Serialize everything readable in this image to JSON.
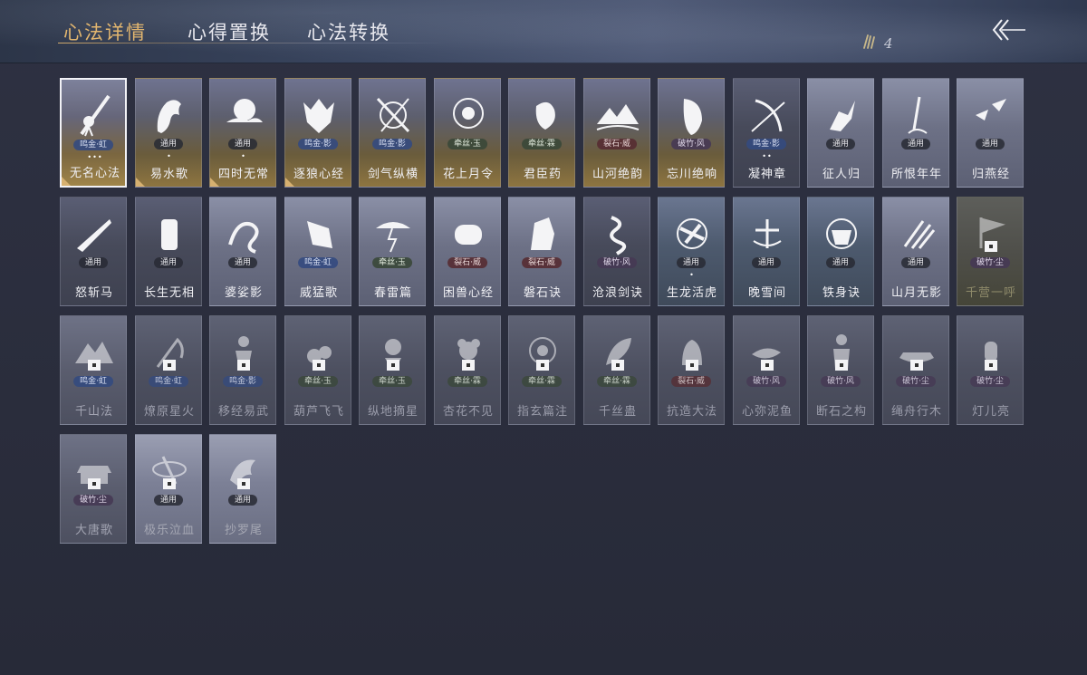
{
  "tabs": [
    {
      "label": "心法详情",
      "active": true
    },
    {
      "label": "心得置换",
      "active": false
    },
    {
      "label": "心法转换",
      "active": false
    }
  ],
  "currency": {
    "icon": "feather-tokens-icon",
    "value": "4"
  },
  "back_icon": "double-chevron-back-icon",
  "cards": [
    {
      "name": "无名心法",
      "tag": "鸣金·虹",
      "tag_color": "blue",
      "dots": "•••",
      "style": "gold first",
      "icon": "sword-pendant",
      "equipped": true,
      "locked": false
    },
    {
      "name": "易水歌",
      "tag": "通用",
      "tag_color": "dark",
      "dots": "•",
      "style": "gold",
      "icon": "horse",
      "equipped": true,
      "locked": false
    },
    {
      "name": "四时无常",
      "tag": "通用",
      "tag_color": "dark",
      "dots": "•",
      "style": "gold",
      "icon": "moon-cloud",
      "equipped": true,
      "locked": false
    },
    {
      "name": "逐狼心经",
      "tag": "鸣金·影",
      "tag_color": "blue",
      "dots": "",
      "style": "gold",
      "icon": "wolf",
      "equipped": true,
      "locked": false
    },
    {
      "name": "剑气纵横",
      "tag": "鸣金·影",
      "tag_color": "blue",
      "dots": "",
      "style": "gold",
      "icon": "swords-crossed",
      "equipped": false,
      "locked": false
    },
    {
      "name": "花上月令",
      "tag": "牵丝·玉",
      "tag_color": "green",
      "dots": "",
      "style": "gold",
      "icon": "flower-moon",
      "equipped": false,
      "locked": false
    },
    {
      "name": "君臣药",
      "tag": "牵丝·霖",
      "tag_color": "green",
      "dots": "",
      "style": "gold",
      "icon": "gourd",
      "equipped": false,
      "locked": false
    },
    {
      "name": "山河绝韵",
      "tag": "裂石·威",
      "tag_color": "red",
      "dots": "",
      "style": "gold",
      "icon": "mountains",
      "equipped": false,
      "locked": false
    },
    {
      "name": "忘川绝响",
      "tag": "破竹·风",
      "tag_color": "purple",
      "dots": "",
      "style": "gold",
      "icon": "mask",
      "equipped": false,
      "locked": false
    },
    {
      "name": "凝神章",
      "tag": "鸣金·影",
      "tag_color": "blue",
      "dots": "••",
      "style": "dark",
      "icon": "bow",
      "equipped": false,
      "locked": false
    },
    {
      "name": "征人归",
      "tag": "通用",
      "tag_color": "dark",
      "dots": "",
      "style": "light",
      "icon": "hand-bird",
      "equipped": false,
      "locked": false
    },
    {
      "name": "所恨年年",
      "tag": "通用",
      "tag_color": "dark",
      "dots": "",
      "style": "light",
      "icon": "tree-moon",
      "equipped": false,
      "locked": false
    },
    {
      "name": "归燕经",
      "tag": "通用",
      "tag_color": "dark",
      "dots": "",
      "style": "light",
      "icon": "swallows",
      "equipped": false,
      "locked": false
    },
    {
      "name": "怒斩马",
      "tag": "通用",
      "tag_color": "dark",
      "dots": "",
      "style": "dark",
      "icon": "blade",
      "equipped": false,
      "locked": false
    },
    {
      "name": "长生无相",
      "tag": "通用",
      "tag_color": "dark",
      "dots": "",
      "style": "dark",
      "icon": "statue",
      "equipped": false,
      "locked": false
    },
    {
      "name": "婆娑影",
      "tag": "通用",
      "tag_color": "dark",
      "dots": "",
      "style": "light",
      "icon": "dragon",
      "equipped": false,
      "locked": false
    },
    {
      "name": "威猛歌",
      "tag": "鸣金·虹",
      "tag_color": "blue",
      "dots": "",
      "style": "light",
      "icon": "fist",
      "equipped": false,
      "locked": false
    },
    {
      "name": "春雷篇",
      "tag": "牵丝·玉",
      "tag_color": "green",
      "dots": "",
      "style": "light",
      "icon": "thunder-tree",
      "equipped": false,
      "locked": false
    },
    {
      "name": "困兽心经",
      "tag": "裂石·威",
      "tag_color": "red",
      "dots": "",
      "style": "light",
      "icon": "cage",
      "equipped": false,
      "locked": false
    },
    {
      "name": "磐石诀",
      "tag": "裂石·威",
      "tag_color": "red",
      "dots": "",
      "style": "light",
      "icon": "rock",
      "equipped": false,
      "locked": false
    },
    {
      "name": "沧浪剑诀",
      "tag": "破竹·风",
      "tag_color": "purple",
      "dots": "",
      "style": "dark",
      "icon": "serpent",
      "equipped": false,
      "locked": false
    },
    {
      "name": "生龙活虎",
      "tag": "通用",
      "tag_color": "dark",
      "dots": "•",
      "style": "teal",
      "icon": "swirl-blade",
      "equipped": false,
      "locked": false
    },
    {
      "name": "晚雪间",
      "tag": "通用",
      "tag_color": "dark",
      "dots": "",
      "style": "teal",
      "icon": "cross-arc",
      "equipped": false,
      "locked": false
    },
    {
      "name": "铁身诀",
      "tag": "通用",
      "tag_color": "dark",
      "dots": "",
      "style": "teal",
      "icon": "strongman",
      "equipped": false,
      "locked": false
    },
    {
      "name": "山月无影",
      "tag": "通用",
      "tag_color": "dark",
      "dots": "",
      "style": "light",
      "icon": "claws",
      "equipped": false,
      "locked": false
    },
    {
      "name": "千营一呼",
      "tag": "破竹·尘",
      "tag_color": "purple",
      "dots": "",
      "style": "olive",
      "icon": "banner",
      "equipped": false,
      "locked": true
    },
    {
      "name": "千山法",
      "tag": "鸣金·虹",
      "tag_color": "blue",
      "dots": "",
      "style": "faded2",
      "icon": "peaks",
      "equipped": false,
      "locked": true
    },
    {
      "name": "燎原星火",
      "tag": "鸣金·虹",
      "tag_color": "blue",
      "dots": "",
      "style": "faded",
      "icon": "scythe",
      "equipped": false,
      "locked": true
    },
    {
      "name": "移经易武",
      "tag": "鸣金·影",
      "tag_color": "blue",
      "dots": "",
      "style": "faded",
      "icon": "figure",
      "equipped": false,
      "locked": true
    },
    {
      "name": "葫芦飞飞",
      "tag": "牵丝·玉",
      "tag_color": "green",
      "dots": "",
      "style": "faded",
      "icon": "gourds",
      "equipped": false,
      "locked": true
    },
    {
      "name": "纵地摘星",
      "tag": "牵丝·玉",
      "tag_color": "green",
      "dots": "",
      "style": "faded",
      "icon": "star-figure",
      "equipped": false,
      "locked": true
    },
    {
      "name": "杏花不见",
      "tag": "牵丝·霖",
      "tag_color": "green",
      "dots": "",
      "style": "faded",
      "icon": "blossom",
      "equipped": false,
      "locked": true
    },
    {
      "name": "指玄篇注",
      "tag": "牵丝·霖",
      "tag_color": "green",
      "dots": "",
      "style": "faded",
      "icon": "yinyang",
      "equipped": false,
      "locked": true
    },
    {
      "name": "千丝蛊",
      "tag": "牵丝·霖",
      "tag_color": "green",
      "dots": "",
      "style": "faded",
      "icon": "leaf",
      "equipped": false,
      "locked": true
    },
    {
      "name": "抗造大法",
      "tag": "裂石·威",
      "tag_color": "red",
      "dots": "",
      "style": "faded",
      "icon": "bell",
      "equipped": false,
      "locked": true
    },
    {
      "name": "心弥泥鱼",
      "tag": "破竹·风",
      "tag_color": "purple",
      "dots": "",
      "style": "faded",
      "icon": "fish",
      "equipped": false,
      "locked": true
    },
    {
      "name": "断石之构",
      "tag": "破竹·风",
      "tag_color": "purple",
      "dots": "",
      "style": "faded",
      "icon": "warrior",
      "equipped": false,
      "locked": true
    },
    {
      "name": "绳舟行木",
      "tag": "破竹·尘",
      "tag_color": "purple",
      "dots": "",
      "style": "faded",
      "icon": "boat",
      "equipped": false,
      "locked": true
    },
    {
      "name": "灯儿亮",
      "tag": "破竹·尘",
      "tag_color": "purple",
      "dots": "",
      "style": "faded",
      "icon": "lantern",
      "equipped": false,
      "locked": true
    },
    {
      "name": "大唐歌",
      "tag": "破竹·尘",
      "tag_color": "purple",
      "dots": "",
      "style": "faded2",
      "icon": "palace",
      "equipped": false,
      "locked": true
    },
    {
      "name": "极乐泣血",
      "tag": "通用",
      "tag_color": "dark",
      "dots": "",
      "style": "lighter",
      "icon": "orbit",
      "equipped": false,
      "locked": true
    },
    {
      "name": "抄罗尾",
      "tag": "通用",
      "tag_color": "dark",
      "dots": "",
      "style": "lighter",
      "icon": "phoenix",
      "equipped": false,
      "locked": true
    }
  ]
}
